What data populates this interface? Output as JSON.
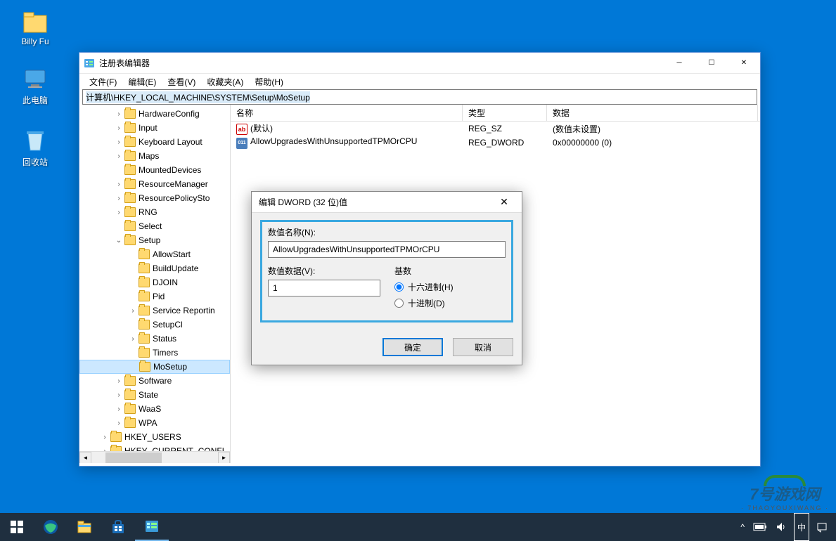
{
  "desktop": {
    "icons": [
      {
        "name": "billy-fu",
        "label": "Billy Fu"
      },
      {
        "name": "this-pc",
        "label": "此电脑"
      },
      {
        "name": "recycle-bin",
        "label": "回收站"
      }
    ]
  },
  "window": {
    "title": "注册表编辑器",
    "menubar": [
      "文件(F)",
      "编辑(E)",
      "查看(V)",
      "收藏夹(A)",
      "帮助(H)"
    ],
    "address": "计算机\\HKEY_LOCAL_MACHINE\\SYSTEM\\Setup\\MoSetup",
    "tree": [
      {
        "indent": 50,
        "exp": ">",
        "label": "HardwareConfig"
      },
      {
        "indent": 50,
        "exp": ">",
        "label": "Input"
      },
      {
        "indent": 50,
        "exp": ">",
        "label": "Keyboard Layout"
      },
      {
        "indent": 50,
        "exp": ">",
        "label": "Maps"
      },
      {
        "indent": 50,
        "exp": "",
        "label": "MountedDevices"
      },
      {
        "indent": 50,
        "exp": ">",
        "label": "ResourceManager"
      },
      {
        "indent": 50,
        "exp": ">",
        "label": "ResourcePolicySto"
      },
      {
        "indent": 50,
        "exp": ">",
        "label": "RNG"
      },
      {
        "indent": 50,
        "exp": "",
        "label": "Select"
      },
      {
        "indent": 50,
        "exp": "v",
        "label": "Setup"
      },
      {
        "indent": 70,
        "exp": "",
        "label": "AllowStart"
      },
      {
        "indent": 70,
        "exp": "",
        "label": "BuildUpdate"
      },
      {
        "indent": 70,
        "exp": "",
        "label": "DJOIN"
      },
      {
        "indent": 70,
        "exp": "",
        "label": "Pid"
      },
      {
        "indent": 70,
        "exp": ">",
        "label": "Service Reportin"
      },
      {
        "indent": 70,
        "exp": "",
        "label": "SetupCl"
      },
      {
        "indent": 70,
        "exp": ">",
        "label": "Status"
      },
      {
        "indent": 70,
        "exp": "",
        "label": "Timers"
      },
      {
        "indent": 70,
        "exp": "",
        "label": "MoSetup",
        "selected": true
      },
      {
        "indent": 50,
        "exp": ">",
        "label": "Software"
      },
      {
        "indent": 50,
        "exp": ">",
        "label": "State"
      },
      {
        "indent": 50,
        "exp": ">",
        "label": "WaaS"
      },
      {
        "indent": 50,
        "exp": ">",
        "label": "WPA"
      },
      {
        "indent": 30,
        "exp": ">",
        "label": "HKEY_USERS"
      },
      {
        "indent": 30,
        "exp": ">",
        "label": "HKEY_CURRENT_CONFI"
      }
    ],
    "list": {
      "headers": {
        "name": "名称",
        "type": "类型",
        "data": "数据"
      },
      "col_widths": {
        "name": 330,
        "type": 120,
        "data": 300
      },
      "rows": [
        {
          "icon": "sz",
          "name": "(默认)",
          "type": "REG_SZ",
          "data": "(数值未设置)"
        },
        {
          "icon": "dw",
          "name": "AllowUpgradesWithUnsupportedTPMOrCPU",
          "type": "REG_DWORD",
          "data": "0x00000000 (0)"
        }
      ]
    }
  },
  "dialog": {
    "title": "编辑 DWORD (32 位)值",
    "name_label": "数值名称(N):",
    "name_value": "AllowUpgradesWithUnsupportedTPMOrCPU",
    "data_label": "数值数据(V):",
    "data_value": "1",
    "base_label": "基数",
    "radio_hex": "十六进制(H)",
    "radio_dec": "十进制(D)",
    "ok": "确定",
    "cancel": "取消"
  },
  "taskbar": {
    "ime": "中"
  },
  "watermark": {
    "main": "7号游戏网",
    "sub": "· 7HAOYOUXIWANG ·"
  }
}
